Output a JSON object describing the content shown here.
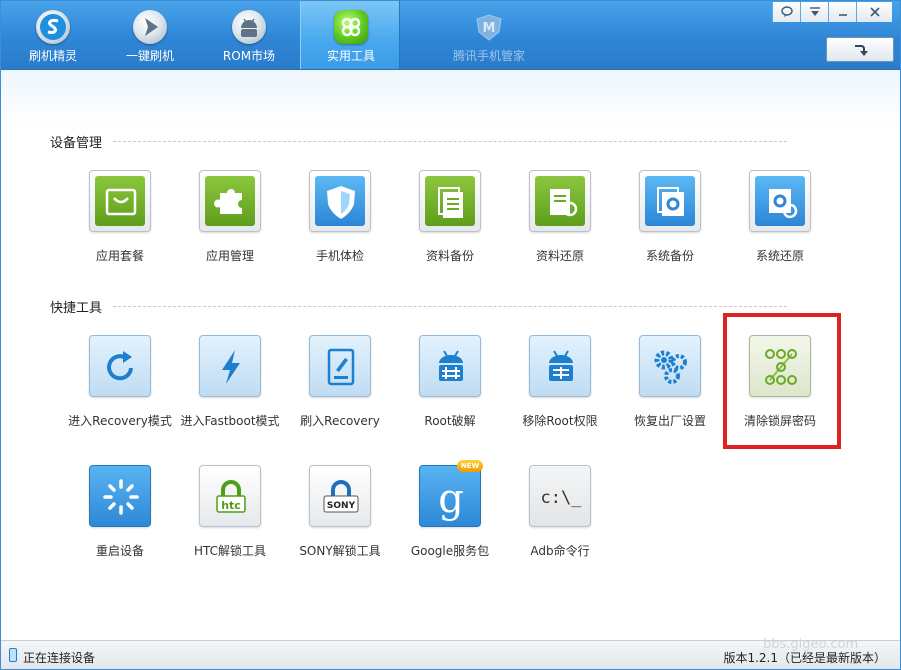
{
  "header": {
    "tabs": [
      {
        "label": "刷机精灵",
        "icon": "shuaji-logo-icon",
        "state": "normal"
      },
      {
        "label": "一键刷机",
        "icon": "one-click-flash-icon",
        "state": "normal"
      },
      {
        "label": "ROM市场",
        "icon": "android-rom-icon",
        "state": "normal"
      },
      {
        "label": "实用工具",
        "icon": "tools-grid-icon",
        "state": "active"
      },
      {
        "label": "腾讯手机管家",
        "icon": "tencent-manager-icon",
        "state": "disabled"
      }
    ],
    "window_buttons": [
      {
        "name": "feedback-icon",
        "glyph": "⌕"
      },
      {
        "name": "menu-icon",
        "glyph": "▽"
      },
      {
        "name": "minimize-icon",
        "glyph": "—"
      },
      {
        "name": "close-icon",
        "glyph": "✕"
      }
    ],
    "refresh_glyph": "➘"
  },
  "sections": {
    "device": {
      "title": "设备管理",
      "tools": [
        {
          "label": "应用套餐",
          "icon": "shopping-bag-icon"
        },
        {
          "label": "应用管理",
          "icon": "puzzle-icon"
        },
        {
          "label": "手机体检",
          "icon": "shield-icon"
        },
        {
          "label": "资料备份",
          "icon": "document-backup-icon"
        },
        {
          "label": "资料还原",
          "icon": "document-restore-icon"
        },
        {
          "label": "系统备份",
          "icon": "system-backup-icon"
        },
        {
          "label": "系统还原",
          "icon": "system-restore-icon"
        }
      ]
    },
    "quick": {
      "title": "快捷工具",
      "tools": [
        {
          "label": "进入Recovery模式",
          "icon": "refresh-arrow-icon"
        },
        {
          "label": "进入Fastboot模式",
          "icon": "lightning-icon"
        },
        {
          "label": "刷入Recovery",
          "icon": "tablet-edit-icon"
        },
        {
          "label": "Root破解",
          "icon": "android-root-icon"
        },
        {
          "label": "移除Root权限",
          "icon": "android-unroot-icon"
        },
        {
          "label": "恢复出厂设置",
          "icon": "gears-icon"
        },
        {
          "label": "清除锁屏密码",
          "icon": "pattern-lock-icon"
        },
        {
          "label": "重启设备",
          "icon": "loading-spinner-icon"
        },
        {
          "label": "HTC解锁工具",
          "icon": "htc-unlock-icon",
          "brand": "htc"
        },
        {
          "label": "SONY解锁工具",
          "icon": "sony-unlock-icon",
          "brand": "SONY"
        },
        {
          "label": "Google服务包",
          "icon": "google-g-icon",
          "brand": "g",
          "badge": "NEW"
        },
        {
          "label": "Adb命令行",
          "icon": "terminal-icon",
          "brand": "c:\\_"
        }
      ]
    }
  },
  "statusbar": {
    "left_text": "正在连接设备",
    "right_text": "版本1.2.1（已经是最新版本）"
  },
  "watermark": "bbs.gigeo.com",
  "colors": {
    "header_blue": "#2f86d6",
    "tile_green": "#6aaa22",
    "tile_blue": "#2e88d8",
    "highlight_red": "#dd2222"
  }
}
